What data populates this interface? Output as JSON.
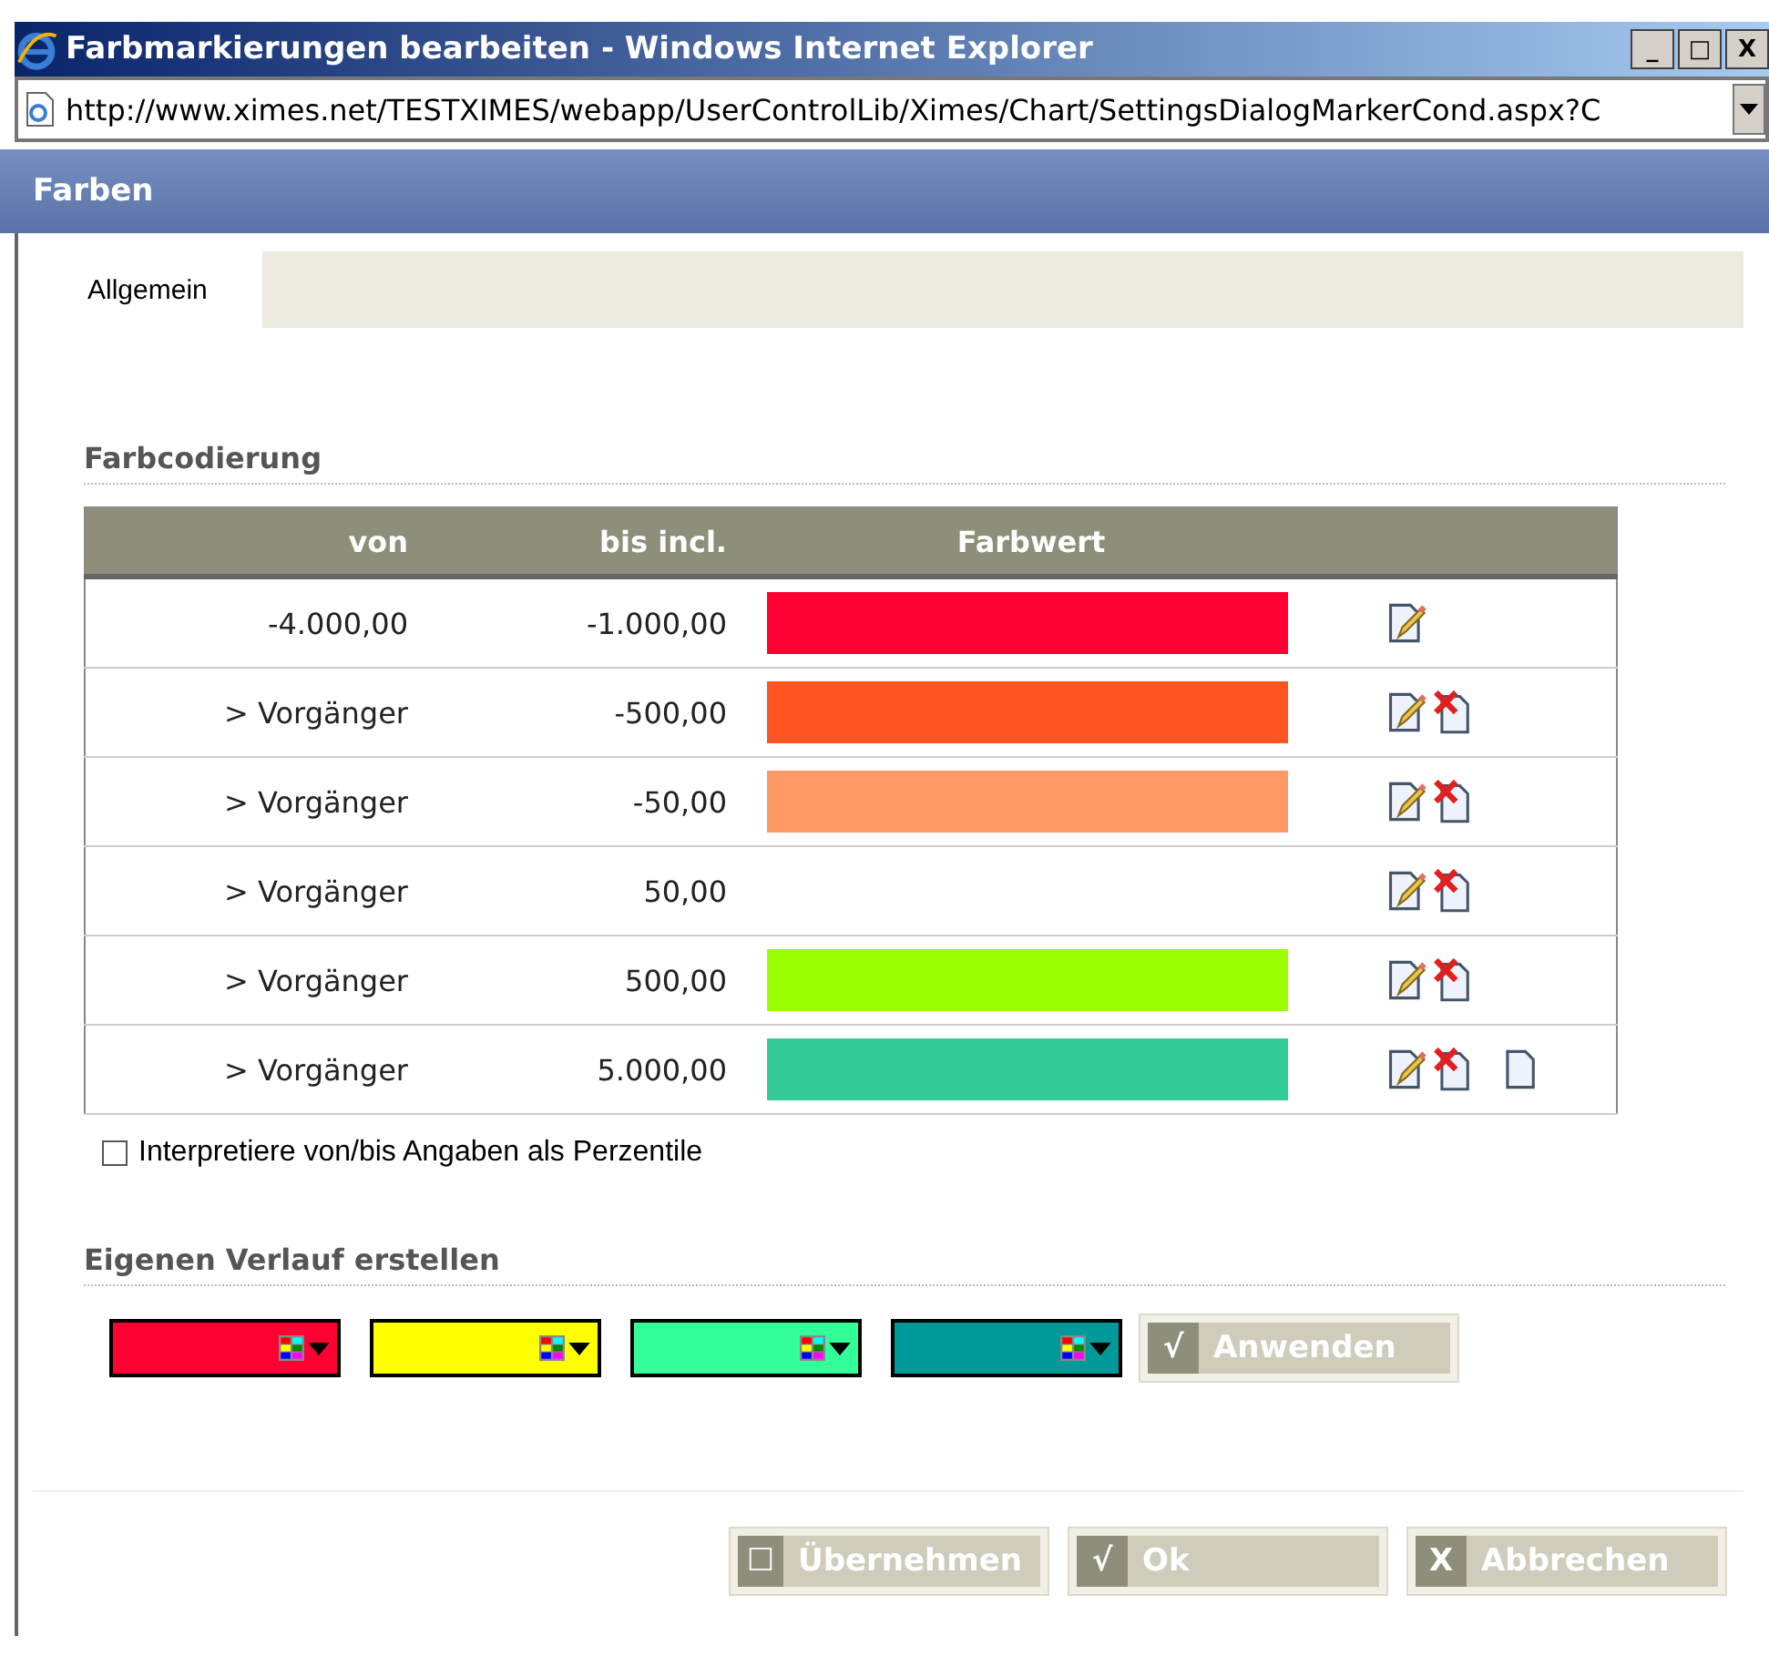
{
  "window": {
    "title": "Farbmarkierungen bearbeiten - Windows Internet Explorer",
    "controls": [
      "_",
      "□",
      "X"
    ]
  },
  "address": {
    "value": "http://www.ximes.net/TESTXIMES/webapp/UserControlLib/Ximes/Chart/SettingsDialogMarkerCond.aspx?C"
  },
  "dialog": {
    "title": "Farben"
  },
  "tabs": [
    {
      "label": "Allgemein",
      "selected": true
    }
  ],
  "farbcodierung": {
    "heading": "Farbcodierung",
    "table": {
      "columns": [
        "von",
        "bis incl.",
        "Farbwert"
      ],
      "rows": [
        {
          "von": "-4.000,00",
          "bis": "-1.000,00",
          "color": "#ff0033",
          "deletable": false,
          "addable": false
        },
        {
          "von": "> Vorgänger",
          "bis": "-500,00",
          "color": "#ff5522",
          "deletable": true,
          "addable": false
        },
        {
          "von": "> Vorgänger",
          "bis": "-50,00",
          "color": "#ff9966",
          "deletable": true,
          "addable": false
        },
        {
          "von": "> Vorgänger",
          "bis": "50,00",
          "deletable": true,
          "addable": false
        },
        {
          "von": "> Vorgänger",
          "bis": "500,00",
          "color": "#99ff00",
          "deletable": true,
          "addable": false
        },
        {
          "von": "> Vorgänger",
          "bis": "5.000,00",
          "color": "#33cc99",
          "deletable": true,
          "addable": true
        }
      ]
    },
    "percentile": {
      "label": "Interpretiere von/bis Angaben als Perzentile",
      "checked": false
    }
  },
  "verlauf": {
    "heading": "Eigenen Verlauf erstellen",
    "pickers": [
      {
        "color": "#ff0033"
      },
      {
        "color": "#ffff00"
      },
      {
        "color": "#33ff99"
      },
      {
        "color": "#009999"
      }
    ],
    "apply": {
      "icon": "√",
      "label": "Anwenden"
    }
  },
  "buttons": [
    {
      "icon": "☐",
      "label": "Übernehmen"
    },
    {
      "icon": "√",
      "label": "Ok"
    },
    {
      "icon": "X",
      "label": "Abbrechen"
    }
  ]
}
